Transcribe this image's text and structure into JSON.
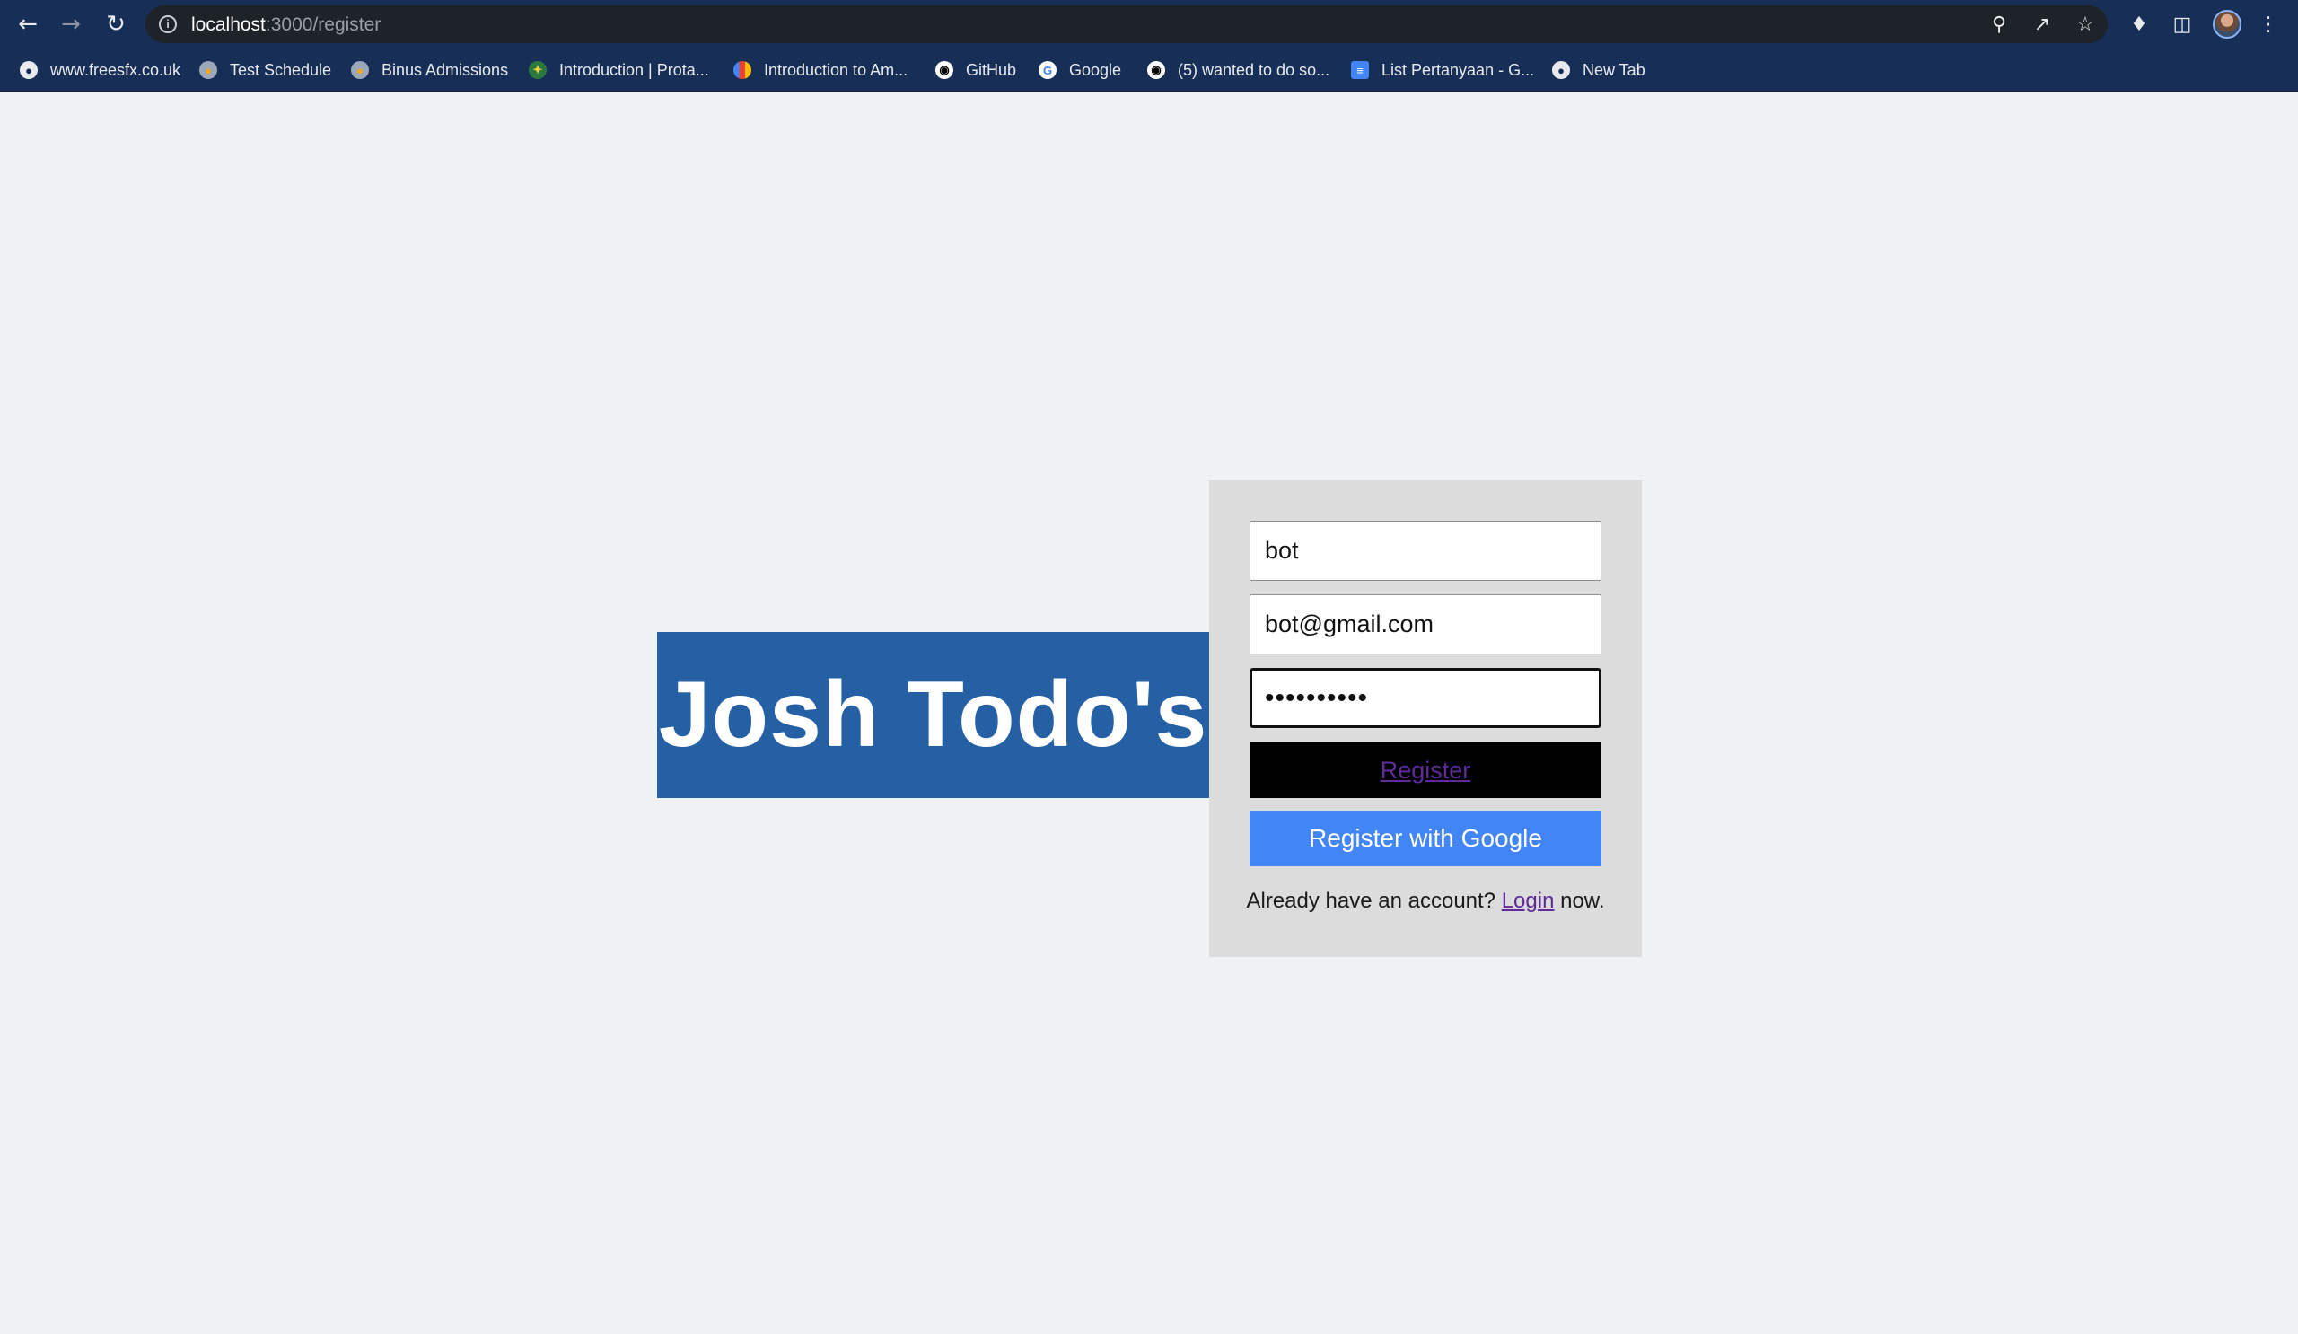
{
  "browser": {
    "url_host": "localhost",
    "url_path": ":3000/register",
    "icons": {
      "back": "arrow-left-icon",
      "forward": "arrow-right-icon",
      "reload": "reload-icon",
      "site_info": "info-icon",
      "key": "key-icon",
      "share": "share-icon",
      "bookmark": "star-icon",
      "extensions": "puzzle-icon",
      "side_panel": "side-panel-icon",
      "menu": "kebab-menu-icon"
    },
    "bookmarks": [
      {
        "label": "www.freesfx.co.uk",
        "icon": "globe-icon"
      },
      {
        "label": "Test Schedule",
        "icon": "eye-icon"
      },
      {
        "label": "Binus Admissions",
        "icon": "eye-icon"
      },
      {
        "label": "Introduction | Prota...",
        "icon": "star-badge-icon"
      },
      {
        "label": "Introduction to Am...",
        "icon": "cloud-icon"
      },
      {
        "label": "GitHub",
        "icon": "github-icon"
      },
      {
        "label": "Google",
        "icon": "google-icon"
      },
      {
        "label": "(5) wanted to do so...",
        "icon": "github-icon"
      },
      {
        "label": "List Pertanyaan - G...",
        "icon": "docs-icon"
      },
      {
        "label": "New Tab",
        "icon": "globe-icon"
      }
    ]
  },
  "page": {
    "brand_title": "Josh Todo's",
    "form": {
      "name_value": "bot",
      "email_value": "bot@gmail.com",
      "password_value": "••••••••••",
      "register_label": "Register",
      "google_label": "Register with Google",
      "login_prefix": "Already have an account?",
      "login_link": "Login",
      "login_suffix": "now."
    }
  },
  "colors": {
    "chrome": "#172f57",
    "brand": "#2660a4",
    "google_button": "#4285f4",
    "register_button": "#000000",
    "panel": "#dcdcdc",
    "page_bg": "#f0f1f3"
  }
}
